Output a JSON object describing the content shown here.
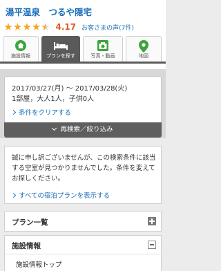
{
  "header": {
    "hotel_name": "湯平温泉　つるや隠宅",
    "rating": {
      "score": "4.17",
      "stars": 4.5,
      "max_stars": 5,
      "reviews_link": "お客さまの声(7件)"
    }
  },
  "tabs": [
    {
      "label": "施設情報",
      "icon": "home-icon",
      "active": false
    },
    {
      "label": "プランを探す",
      "icon": "bed-icon",
      "active": true
    },
    {
      "label": "写真・動画",
      "icon": "camera-icon",
      "active": false
    },
    {
      "label": "地図",
      "icon": "map-pin-icon",
      "active": false
    }
  ],
  "search": {
    "dates": "2017/03/27(月) 〜 2017/03/28(火)",
    "people": "1部屋，大人1人，子供0人",
    "clear_link": "条件をクリアする",
    "research_button": "再検索／絞り込み"
  },
  "notice": {
    "message": "誠に申し訳ございませんが、この検索条件に該当する空室が見つかりませんでした。条件を変えてお探しください。",
    "all_plans_link": "すべての宿泊プランを表示する"
  },
  "sections": {
    "plans_title": "プラン一覧",
    "facility_title": "施設情報",
    "facility_top": "施設情報トップ"
  },
  "colors": {
    "link": "#1c6fb8",
    "score": "#e05a1c",
    "star": "#f5a623",
    "tab_active": "#5a5a5a"
  }
}
